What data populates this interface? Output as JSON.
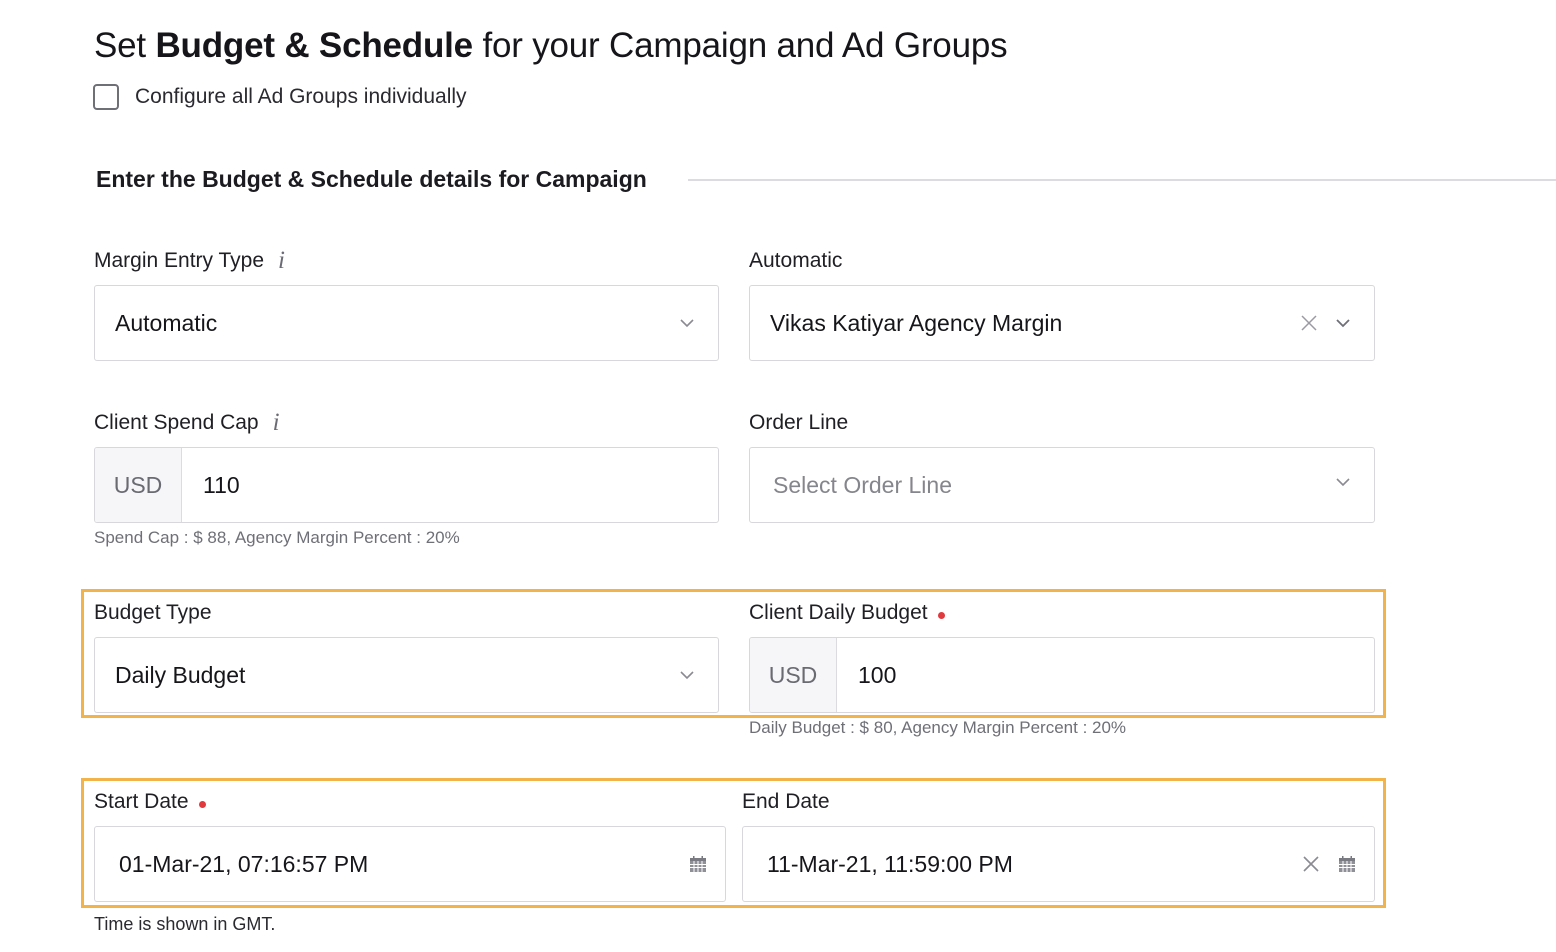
{
  "page": {
    "title_prefix": "Set ",
    "title_bold": "Budget & Schedule",
    "title_suffix": " for your Campaign and Ad Groups",
    "configure_checkbox": {
      "label": "Configure all Ad Groups individually",
      "checked": false
    },
    "section_title": "Enter the Budget & Schedule details for Campaign"
  },
  "fields": {
    "margin_entry_type": {
      "label": "Margin Entry Type",
      "info_icon": "info-icon",
      "value": "Automatic"
    },
    "automatic": {
      "label": "Automatic",
      "value": "Vikas Katiyar Agency Margin"
    },
    "client_spend_cap": {
      "label": "Client Spend Cap",
      "info_icon": "info-icon",
      "currency": "USD",
      "value": "110",
      "hint": "Spend Cap : $ 88, Agency Margin Percent : 20%"
    },
    "order_line": {
      "label": "Order Line",
      "placeholder": "Select Order Line"
    },
    "budget_type": {
      "label": "Budget Type",
      "value": "Daily Budget"
    },
    "client_daily_budget": {
      "label": "Client Daily Budget",
      "required": true,
      "currency": "USD",
      "value": "100",
      "hint": "Daily Budget : $ 80, Agency Margin Percent : 20%"
    },
    "start_date": {
      "label": "Start Date",
      "required": true,
      "value": "01-Mar-21, 07:16:57 PM"
    },
    "end_date": {
      "label": "End Date",
      "value": "11-Mar-21, 11:59:00 PM"
    },
    "timezone_note": "Time is shown in GMT."
  },
  "colors": {
    "highlight": "#f2b34a",
    "required": "#e0393e",
    "border": "#d8d8dc",
    "addon_bg": "#f6f6f8"
  }
}
